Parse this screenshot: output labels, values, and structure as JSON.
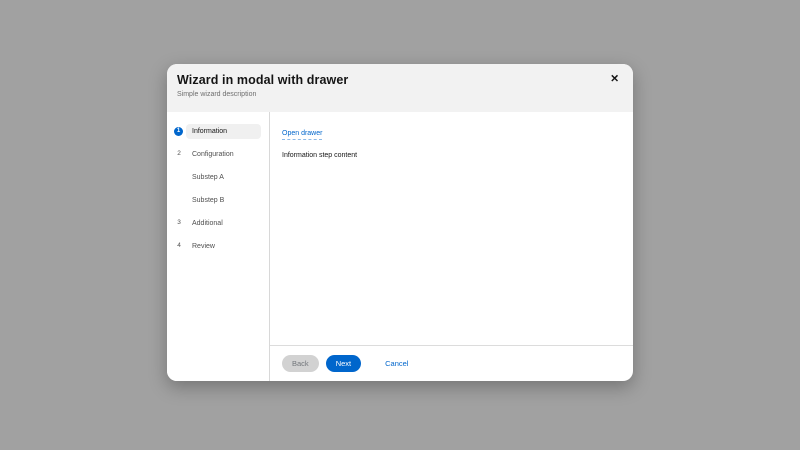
{
  "colors": {
    "backdrop": "#a1a1a1",
    "header_bg": "#f2f2f2",
    "accent_blue": "#0066cc",
    "current_step_bg": "#f0f0f0",
    "disabled_button_bg": "#d2d2d2"
  },
  "modal": {
    "title": "Wizard in modal with drawer",
    "description": "Simple wizard description",
    "close_icon": "✕"
  },
  "wizard": {
    "steps": [
      {
        "number": "1",
        "label": "Information",
        "current": true
      },
      {
        "number": "2",
        "label": "Configuration",
        "current": false,
        "substeps": [
          "Substep A",
          "Substep B"
        ]
      },
      {
        "number": "3",
        "label": "Additional",
        "current": false
      },
      {
        "number": "4",
        "label": "Review",
        "current": false
      }
    ],
    "content": {
      "link_label": "Open drawer",
      "body_text": "Information step content"
    },
    "footer": {
      "back_label": "Back",
      "next_label": "Next",
      "cancel_label": "Cancel"
    }
  }
}
